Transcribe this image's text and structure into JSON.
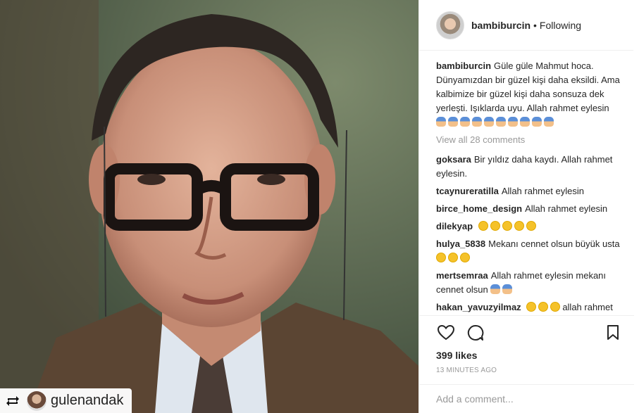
{
  "post": {
    "repost_user": "gulenandak",
    "icons": {
      "repost": "repost-icon",
      "like": "heart-icon",
      "comment": "comment-icon",
      "save": "bookmark-icon"
    }
  },
  "header": {
    "username": "bambiburcin",
    "separator": "•",
    "follow_status": "Following"
  },
  "caption": {
    "user": "bambiburcin",
    "text": "Güle güle Mahmut hoca. Dünyamızdan bir güzel kişi daha eksildi. Ama kalbimize bir güzel kişi daha sonsuza dek yerleşti. Işıklarda uyu. Allah rahmet eylesin",
    "emoji_count": 10,
    "emoji": "pray"
  },
  "view_all": "View all 28 comments",
  "comments": [
    {
      "user": "goksara",
      "text": "Bir yıldız daha kaydı. Allah rahmet eylesin.",
      "emoji": "",
      "emoji_count": 0,
      "after": ""
    },
    {
      "user": "tcaynureratilla",
      "text": "Allah rahmet eylesin",
      "emoji": "",
      "emoji_count": 0,
      "after": ""
    },
    {
      "user": "birce_home_design",
      "text": "Allah rahmet eylesin",
      "emoji": "",
      "emoji_count": 0,
      "after": ""
    },
    {
      "user": "dilekyap",
      "text": "",
      "emoji": "sad",
      "emoji_count": 5,
      "after": ""
    },
    {
      "user": "hulya_5838",
      "text": "Mekanı cennet olsun büyük usta",
      "emoji": "sad",
      "emoji_count": 3,
      "after": ""
    },
    {
      "user": "mertsemraa",
      "text": "Allah rahmet eylesin mekanı cennet olsun",
      "emoji": "pray",
      "emoji_count": 2,
      "after": ""
    },
    {
      "user": "hakan_yavuzyilmaz",
      "text": "",
      "emoji": "sad",
      "emoji_count": 3,
      "after": "allah rahmet eylesin"
    }
  ],
  "likes": "399 likes",
  "timestamp": "13 MINUTES AGO",
  "add_comment": {
    "placeholder": "Add a comment..."
  }
}
